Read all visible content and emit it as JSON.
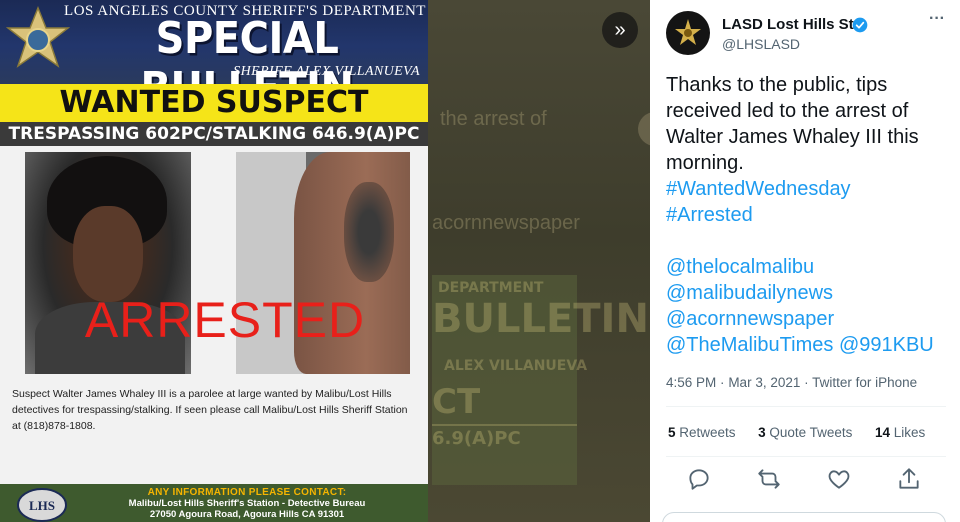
{
  "viewer": {
    "expand_icon": "chevron-double-right-icon",
    "expand_glyph": "»",
    "background_ghost": {
      "text1": "the arrest of",
      "text2": "acornnewspaper",
      "poster_line1": "DEPARTMENT",
      "poster_line2": "BULLETIN",
      "poster_line3": "ALEX VILLANUEVA",
      "poster_line4": "CT",
      "poster_line5": "6.9(A)PC"
    }
  },
  "poster": {
    "department": "LOS ANGELES COUNTY SHERIFF'S DEPARTMENT",
    "bulletin": "SPECIAL BULLETIN",
    "sheriff": "SHERIFF ALEX VILLANUEVA",
    "wanted": "WANTED SUSPECT",
    "charge": "TRESPASSING 602PC/STALKING 646.9(A)PC",
    "stamp": "ARRESTED",
    "description": "Suspect Walter James Whaley III is a parolee at large wanted by Malibu/Lost Hills detectives for trespassing/stalking. If seen please call Malibu/Lost Hills Sheriff Station at (818)878-1808.",
    "contact_title": "ANY INFORMATION PLEASE CONTACT:",
    "contact_line1": "Malibu/Lost Hills Sheriff's Station - Detective Bureau",
    "contact_line2": "27050 Agoura Road, Agoura Hills CA 91301",
    "badge_text": "LHS",
    "colors": {
      "header": "#22366c",
      "wanted_bar": "#f5e418",
      "stamp": "#e8201a",
      "contact_bar": "#3e5a2e",
      "contact_title": "#f5b400"
    }
  },
  "tweet": {
    "author_name": "LASD Lost Hills Stn.",
    "author_handle": "@LHSLASD",
    "verified_icon": "verified-badge-icon",
    "more_icon": "more-options-icon",
    "more_glyph": "···",
    "text_lines": [
      "Thanks to the public, tips",
      "received led to the arrest of",
      "Walter James Whaley III this",
      "morning."
    ],
    "hashtags": [
      "#WantedWednesday",
      "#Arrested"
    ],
    "mentions": [
      "@thelocalmalibu",
      "@malibudailynews",
      "@acornnewspaper",
      "@TheMalibuTimes",
      "@991KBU"
    ],
    "time": "4:56 PM",
    "date": "Mar 3, 2021",
    "source": "Twitter for iPhone",
    "separator": "·",
    "retweets_count": "5",
    "retweets_label": "Retweets",
    "quotes_count": "3",
    "quotes_label": "Quote Tweets",
    "likes_count": "14",
    "likes_label": "Likes",
    "actions": [
      "reply-icon",
      "retweet-icon",
      "like-icon",
      "share-icon"
    ],
    "link_color": "#1d9bf0"
  }
}
